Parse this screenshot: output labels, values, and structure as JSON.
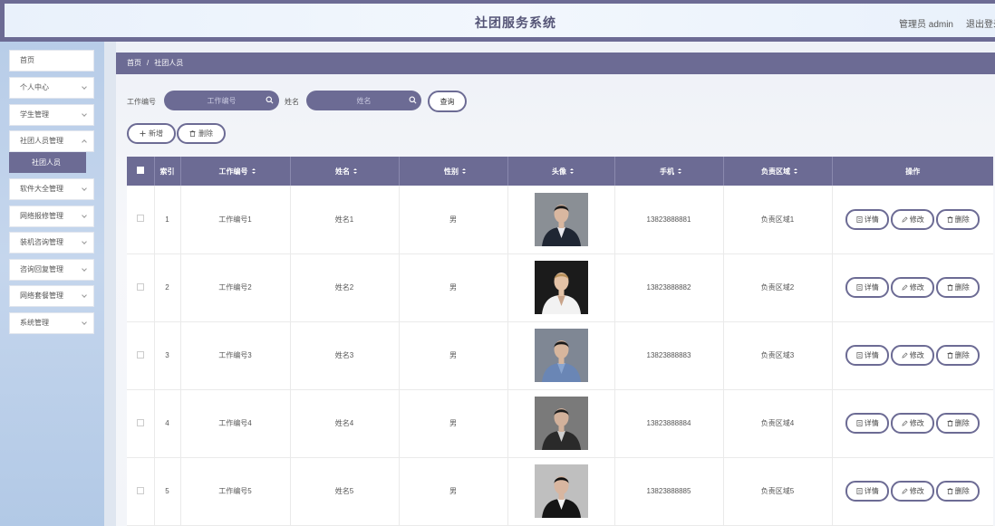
{
  "header": {
    "title": "社团服务系统",
    "admin_label": "管理员 admin",
    "logout_label": "退出登录"
  },
  "sidebar": {
    "items": [
      {
        "label": "首页",
        "has_arrow": false
      },
      {
        "label": "个人中心",
        "has_arrow": true
      },
      {
        "label": "学生管理",
        "has_arrow": true
      },
      {
        "label": "社团人员管理",
        "has_arrow": true
      },
      {
        "label": "软件大全管理",
        "has_arrow": true
      },
      {
        "label": "网络报修管理",
        "has_arrow": true
      },
      {
        "label": "装机咨询管理",
        "has_arrow": true
      },
      {
        "label": "咨询回复管理",
        "has_arrow": true
      },
      {
        "label": "网络套餐管理",
        "has_arrow": true
      },
      {
        "label": "系统管理",
        "has_arrow": true
      }
    ],
    "active_sub": "社团人员"
  },
  "breadcrumb": {
    "home": "首页",
    "separator": "/",
    "current": "社团人员"
  },
  "search": {
    "job_label": "工作编号",
    "job_placeholder": "工作编号",
    "name_label": "姓名",
    "name_placeholder": "姓名",
    "query_button": "查询"
  },
  "actions": {
    "add": "新增",
    "delete": "删除"
  },
  "table": {
    "columns": [
      "索引",
      "工作编号",
      "姓名",
      "性别",
      "头像",
      "手机",
      "负责区域",
      "操作"
    ],
    "row_actions": {
      "detail": "详情",
      "edit": "修改",
      "delete": "删除"
    },
    "rows": [
      {
        "index": "1",
        "job_no": "工作编号1",
        "name": "姓名1",
        "gender": "男",
        "phone": "13823888881",
        "area": "负责区域1"
      },
      {
        "index": "2",
        "job_no": "工作编号2",
        "name": "姓名2",
        "gender": "男",
        "phone": "13823888882",
        "area": "负责区域2"
      },
      {
        "index": "3",
        "job_no": "工作编号3",
        "name": "姓名3",
        "gender": "男",
        "phone": "13823888883",
        "area": "负责区域3"
      },
      {
        "index": "4",
        "job_no": "工作编号4",
        "name": "姓名4",
        "gender": "男",
        "phone": "13823888884",
        "area": "负责区域4"
      },
      {
        "index": "5",
        "job_no": "工作编号5",
        "name": "姓名5",
        "gender": "男",
        "phone": "13823888885",
        "area": "负责区域5"
      }
    ]
  },
  "colors": {
    "accent": "#6c6b94",
    "sidebar_bg": "#b8cde8",
    "header_bg": "#eaf2fb"
  }
}
